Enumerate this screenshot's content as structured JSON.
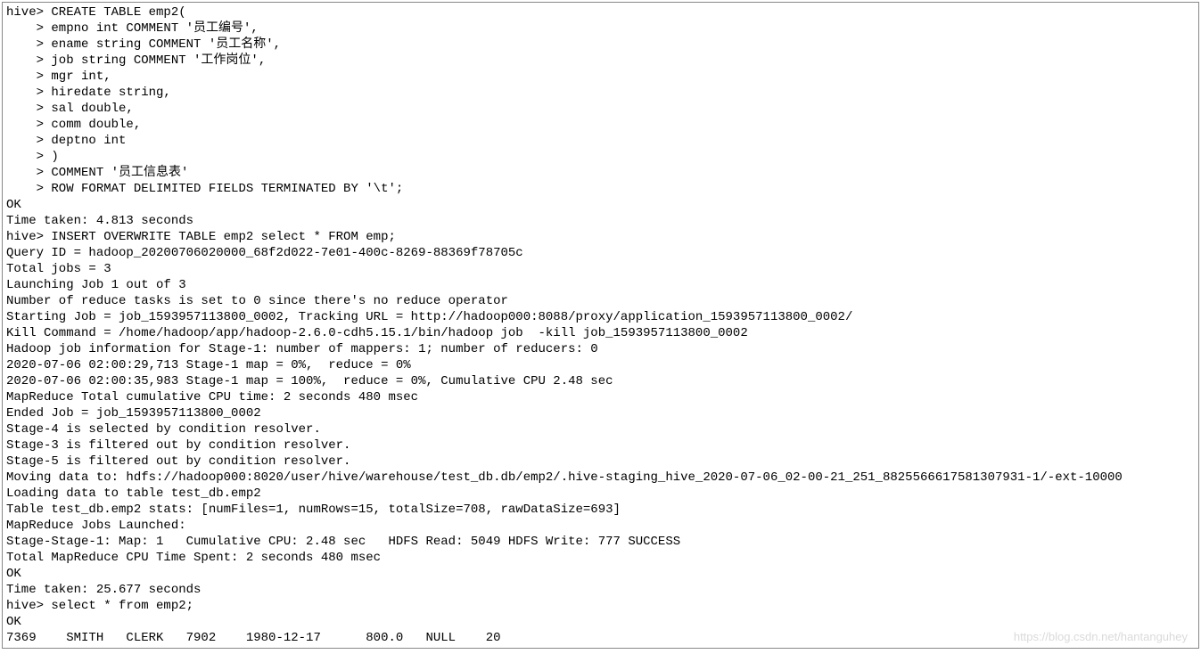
{
  "terminal": {
    "lines": [
      "hive> CREATE TABLE emp2(",
      "    > empno int COMMENT '员工编号',",
      "    > ename string COMMENT '员工名称',",
      "    > job string COMMENT '工作岗位',",
      "    > mgr int,",
      "    > hiredate string,",
      "    > sal double,",
      "    > comm double,",
      "    > deptno int",
      "    > )",
      "    > COMMENT '员工信息表'",
      "    > ROW FORMAT DELIMITED FIELDS TERMINATED BY '\\t';",
      "OK",
      "Time taken: 4.813 seconds",
      "hive> INSERT OVERWRITE TABLE emp2 select * FROM emp;",
      "Query ID = hadoop_20200706020000_68f2d022-7e01-400c-8269-88369f78705c",
      "Total jobs = 3",
      "Launching Job 1 out of 3",
      "Number of reduce tasks is set to 0 since there's no reduce operator",
      "Starting Job = job_1593957113800_0002, Tracking URL = http://hadoop000:8088/proxy/application_1593957113800_0002/",
      "Kill Command = /home/hadoop/app/hadoop-2.6.0-cdh5.15.1/bin/hadoop job  -kill job_1593957113800_0002",
      "Hadoop job information for Stage-1: number of mappers: 1; number of reducers: 0",
      "2020-07-06 02:00:29,713 Stage-1 map = 0%,  reduce = 0%",
      "2020-07-06 02:00:35,983 Stage-1 map = 100%,  reduce = 0%, Cumulative CPU 2.48 sec",
      "MapReduce Total cumulative CPU time: 2 seconds 480 msec",
      "Ended Job = job_1593957113800_0002",
      "Stage-4 is selected by condition resolver.",
      "Stage-3 is filtered out by condition resolver.",
      "Stage-5 is filtered out by condition resolver.",
      "Moving data to: hdfs://hadoop000:8020/user/hive/warehouse/test_db.db/emp2/.hive-staging_hive_2020-07-06_02-00-21_251_8825566617581307931-1/-ext-10000",
      "Loading data to table test_db.emp2",
      "Table test_db.emp2 stats: [numFiles=1, numRows=15, totalSize=708, rawDataSize=693]",
      "MapReduce Jobs Launched:",
      "Stage-Stage-1: Map: 1   Cumulative CPU: 2.48 sec   HDFS Read: 5049 HDFS Write: 777 SUCCESS",
      "Total MapReduce CPU Time Spent: 2 seconds 480 msec",
      "OK",
      "Time taken: 25.677 seconds",
      "hive> select * from emp2;",
      "OK",
      "7369    SMITH   CLERK   7902    1980-12-17      800.0   NULL    20"
    ]
  },
  "watermark": {
    "text": "https://blog.csdn.net/hantanguhey"
  }
}
